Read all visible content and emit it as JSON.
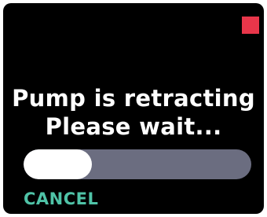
{
  "status_indicator": {
    "color": "#e8364a"
  },
  "message": {
    "line1": "Pump is retracting",
    "line2": "Please wait..."
  },
  "progress": {
    "fraction": 0.3,
    "fill_color": "#ffffff",
    "track_color": "#6b6d80"
  },
  "cancel_button": {
    "label": "CANCEL",
    "color": "#4fc3a7"
  }
}
